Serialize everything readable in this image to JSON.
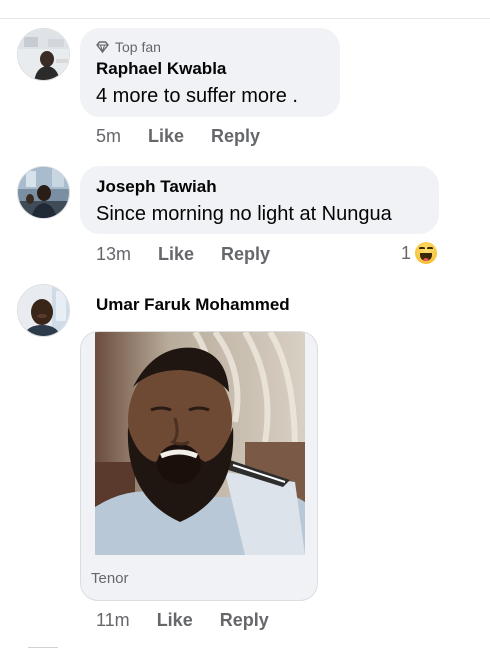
{
  "comments": [
    {
      "badge": "Top fan",
      "badge_icon": "diamond-icon",
      "author": "Raphael Kwabla",
      "text": "4 more to suffer more .",
      "time": "5m",
      "like_label": "Like",
      "reply_label": "Reply"
    },
    {
      "author": "Joseph Tawiah",
      "text": "Since morning no light at Nungua",
      "time": "13m",
      "like_label": "Like",
      "reply_label": "Reply",
      "reaction_count": "1",
      "reaction_icon": "haha-reaction-icon"
    },
    {
      "author": "Umar Faruk Mohammed",
      "gif_source": "Tenor",
      "time": "11m",
      "like_label": "Like",
      "reply_label": "Reply"
    }
  ],
  "colors": {
    "bubble": "#f0f2f5",
    "meta_text": "#65676b",
    "primary_text": "#050505",
    "divider": "#e4e6eb"
  }
}
